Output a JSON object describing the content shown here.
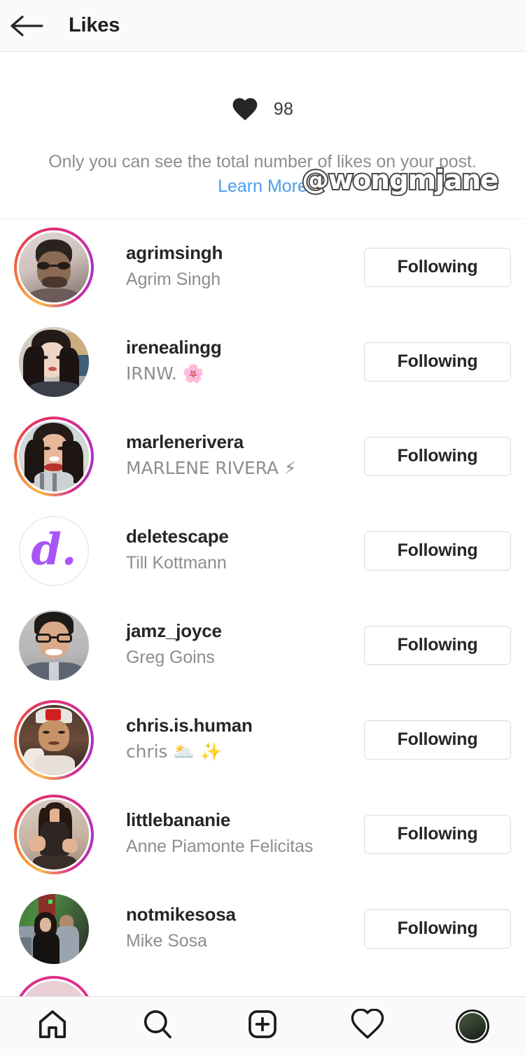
{
  "header": {
    "back_icon": "arrow-left-icon",
    "title": "Likes"
  },
  "banner": {
    "heart_icon": "heart-filled-icon",
    "like_count": "98",
    "note": "Only you can see the total number of likes on your post.",
    "learn_more": "Learn More",
    "learn_more_color": "#4a9ef0"
  },
  "watermark": {
    "text": "@wongmjane"
  },
  "list": {
    "follow_label": "Following",
    "items": [
      {
        "username": "agrimsingh",
        "fullname": "Agrim Singh",
        "has_story_ring": true,
        "avatar_kind": "photo-portrait-glasses",
        "button": "Following"
      },
      {
        "username": "irenealingg",
        "fullname": "IRNW. 🌸",
        "has_story_ring": false,
        "avatar_kind": "photo-portrait-darkhair",
        "button": "Following"
      },
      {
        "username": "marlenerivera",
        "fullname": "MARLENE RIVERA ⚡",
        "has_story_ring": true,
        "avatar_kind": "photo-portrait-beach",
        "button": "Following"
      },
      {
        "username": "deletescape",
        "fullname": "Till Kottmann",
        "has_story_ring": false,
        "avatar_kind": "logo-d-purple",
        "button": "Following"
      },
      {
        "username": "jamz_joyce",
        "fullname": "Greg Goins",
        "has_story_ring": false,
        "avatar_kind": "photo-portrait-gray",
        "button": "Following"
      },
      {
        "username": "chris.is.human",
        "fullname": "chris 🌥️ ✨",
        "has_story_ring": true,
        "avatar_kind": "photo-portrait-cap",
        "button": "Following"
      },
      {
        "username": "littlebananie",
        "fullname": "Anne Piamonte Felicitas",
        "has_story_ring": true,
        "avatar_kind": "photo-portrait-seated",
        "button": "Following"
      },
      {
        "username": "notmikesosa",
        "fullname": "Mike Sosa",
        "has_story_ring": false,
        "avatar_kind": "photo-group-green",
        "button": "Following"
      }
    ]
  },
  "navbar": {
    "items": [
      {
        "name": "home",
        "icon": "home-icon"
      },
      {
        "name": "search",
        "icon": "search-icon"
      },
      {
        "name": "create",
        "icon": "plus-square-icon"
      },
      {
        "name": "activity",
        "icon": "heart-outline-icon"
      },
      {
        "name": "profile",
        "icon": "profile-avatar-icon"
      }
    ]
  }
}
